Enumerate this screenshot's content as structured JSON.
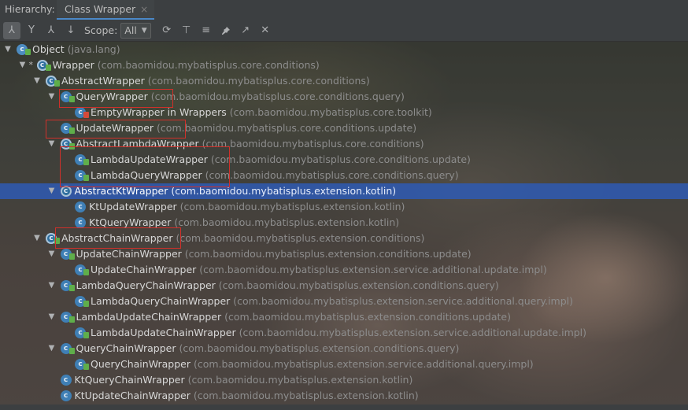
{
  "tabbar": {
    "hierarchy_label": "Hierarchy:",
    "tab_label": "Class Wrapper",
    "close_glyph": "×"
  },
  "toolbar": {
    "buttons": [
      {
        "name": "class-hierarchy-icon",
        "glyph": "⅄"
      },
      {
        "name": "supertypes-hierarchy-icon",
        "glyph": "Y"
      },
      {
        "name": "subtypes-hierarchy-icon",
        "glyph": "⅄"
      },
      {
        "name": "sort-alphabetically-icon",
        "glyph": "↓"
      }
    ],
    "scope_label": "Scope:",
    "scope_value": "All",
    "right_buttons": [
      {
        "name": "refresh-icon",
        "glyph": "⟳"
      },
      {
        "name": "base-on-this-class-icon",
        "glyph": "⊤"
      },
      {
        "name": "expand-all-icon",
        "glyph": "≡"
      },
      {
        "name": "pin-icon",
        "glyph": "📌"
      },
      {
        "name": "export-icon",
        "glyph": "↗"
      },
      {
        "name": "close-icon",
        "glyph": "✕"
      }
    ]
  },
  "tree": [
    {
      "name": "Object",
      "pkg": "(java.lang)",
      "level": 0,
      "arrow": "▼",
      "kind": "obj",
      "lock": "green"
    },
    {
      "name": "Wrapper",
      "pkg": "(com.baomidou.mybatisplus.core.conditions)",
      "level": 1,
      "arrow": "▼",
      "kind": "abstract",
      "lock": "green",
      "star": "*"
    },
    {
      "name": "AbstractWrapper",
      "pkg": "(com.baomidou.mybatisplus.core.conditions)",
      "level": 2,
      "arrow": "▼",
      "kind": "abstract",
      "lock": "green"
    },
    {
      "name": "QueryWrapper",
      "pkg": "(com.baomidou.mybatisplus.core.conditions.query)",
      "level": 3,
      "arrow": "▼",
      "kind": "class",
      "lock": "green"
    },
    {
      "name": "EmptyWrapper in Wrappers",
      "pkg": "(com.baomidou.mybatisplus.core.toolkit)",
      "level": 4,
      "arrow": "",
      "kind": "class",
      "lock": "red"
    },
    {
      "name": "UpdateWrapper",
      "pkg": "(com.baomidou.mybatisplus.core.conditions.update)",
      "level": 3,
      "arrow": "",
      "kind": "class",
      "lock": "green"
    },
    {
      "name": "AbstractLambdaWrapper",
      "pkg": "(com.baomidou.mybatisplus.core.conditions)",
      "level": 3,
      "arrow": "▼",
      "kind": "abstract",
      "lock": "green"
    },
    {
      "name": "LambdaUpdateWrapper",
      "pkg": "(com.baomidou.mybatisplus.core.conditions.update)",
      "level": 4,
      "arrow": "",
      "kind": "class",
      "lock": "green"
    },
    {
      "name": "LambdaQueryWrapper",
      "pkg": "(com.baomidou.mybatisplus.core.conditions.query)",
      "level": 4,
      "arrow": "",
      "kind": "class",
      "lock": "green"
    },
    {
      "name": "AbstractKtWrapper",
      "pkg": "(com.baomidou.mybatisplus.extension.kotlin)",
      "level": 3,
      "arrow": "▼",
      "kind": "abstract",
      "lock": "",
      "selected": true
    },
    {
      "name": "KtUpdateWrapper",
      "pkg": "(com.baomidou.mybatisplus.extension.kotlin)",
      "level": 4,
      "arrow": "",
      "kind": "class",
      "lock": ""
    },
    {
      "name": "KtQueryWrapper",
      "pkg": "(com.baomidou.mybatisplus.extension.kotlin)",
      "level": 4,
      "arrow": "",
      "kind": "class",
      "lock": ""
    },
    {
      "name": "AbstractChainWrapper",
      "pkg": "(com.baomidou.mybatisplus.extension.conditions)",
      "level": 2,
      "arrow": "▼",
      "kind": "abstract",
      "lock": "green"
    },
    {
      "name": "UpdateChainWrapper",
      "pkg": "(com.baomidou.mybatisplus.extension.conditions.update)",
      "level": 3,
      "arrow": "▼",
      "kind": "class",
      "lock": "green"
    },
    {
      "name": "UpdateChainWrapper",
      "pkg": "(com.baomidou.mybatisplus.extension.service.additional.update.impl)",
      "level": 4,
      "arrow": "",
      "kind": "class",
      "lock": "green"
    },
    {
      "name": "LambdaQueryChainWrapper",
      "pkg": "(com.baomidou.mybatisplus.extension.conditions.query)",
      "level": 3,
      "arrow": "▼",
      "kind": "class",
      "lock": "green"
    },
    {
      "name": "LambdaQueryChainWrapper",
      "pkg": "(com.baomidou.mybatisplus.extension.service.additional.query.impl)",
      "level": 4,
      "arrow": "",
      "kind": "class",
      "lock": "green"
    },
    {
      "name": "LambdaUpdateChainWrapper",
      "pkg": "(com.baomidou.mybatisplus.extension.conditions.update)",
      "level": 3,
      "arrow": "▼",
      "kind": "class",
      "lock": "green"
    },
    {
      "name": "LambdaUpdateChainWrapper",
      "pkg": "(com.baomidou.mybatisplus.extension.service.additional.update.impl)",
      "level": 4,
      "arrow": "",
      "kind": "class",
      "lock": "green"
    },
    {
      "name": "QueryChainWrapper",
      "pkg": "(com.baomidou.mybatisplus.extension.conditions.query)",
      "level": 3,
      "arrow": "▼",
      "kind": "class",
      "lock": "green"
    },
    {
      "name": "QueryChainWrapper",
      "pkg": "(com.baomidou.mybatisplus.extension.service.additional.query.impl)",
      "level": 4,
      "arrow": "",
      "kind": "class",
      "lock": "green"
    },
    {
      "name": "KtQueryChainWrapper",
      "pkg": "(com.baomidou.mybatisplus.extension.kotlin)",
      "level": 3,
      "arrow": "",
      "kind": "class",
      "lock": ""
    },
    {
      "name": "KtUpdateChainWrapper",
      "pkg": "(com.baomidou.mybatisplus.extension.kotlin)",
      "level": 3,
      "arrow": "",
      "kind": "class",
      "lock": ""
    }
  ],
  "highlight_color": "#d0302a",
  "selection_color": "#2e5ab4"
}
